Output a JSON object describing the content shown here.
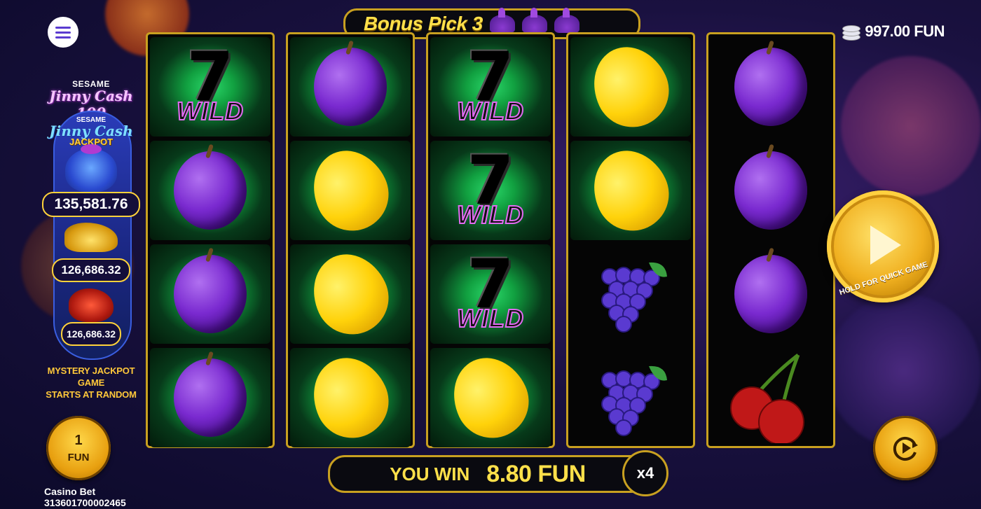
{
  "header": {
    "bonus_pick_label": "Bonus Pick 3",
    "balance": "997.00 FUN"
  },
  "sidebar": {
    "brand_small": "SESAME",
    "brand_name": "Jinny Cash 100",
    "jackpot_small": "SESAME",
    "jackpot_name": "Jinny Cash",
    "jackpot_word": "JACKPOT",
    "jackpot_values": [
      "135,581.76",
      "126,686.32",
      "126,686.32"
    ],
    "mystery_line1": "MYSTERY JACKPOT GAME",
    "mystery_line2": "STARTS AT RANDOM"
  },
  "bet": {
    "value": "1",
    "unit": "FUN",
    "casino_bet_label": "Casino Bet",
    "bet_id": "313601700002465"
  },
  "reels": [
    [
      "seven",
      "plum",
      "plum",
      "plum"
    ],
    [
      "plum",
      "lemon",
      "lemon",
      "lemon"
    ],
    [
      "seven",
      "seven",
      "seven",
      "lemon"
    ],
    [
      "lemon",
      "lemon",
      "grapes",
      "grapes"
    ],
    [
      "plum",
      "plum",
      "plum",
      "cherry"
    ]
  ],
  "winning_cells": [
    [
      true,
      true,
      true,
      true
    ],
    [
      true,
      true,
      true,
      true
    ],
    [
      true,
      true,
      true,
      true
    ],
    [
      true,
      true,
      false,
      false
    ],
    [
      false,
      false,
      false,
      false
    ]
  ],
  "wild_symbol": {
    "number": "7",
    "word": "WILD"
  },
  "win": {
    "label": "YOU WIN",
    "amount": "8.80 FUN",
    "multiplier": "x4"
  },
  "spin": {
    "hold_text": "HOLD FOR QUICK GAME"
  },
  "colors": {
    "gold": "#c8a020",
    "win_text": "#ffe04a",
    "win_cell": "#11a040"
  }
}
